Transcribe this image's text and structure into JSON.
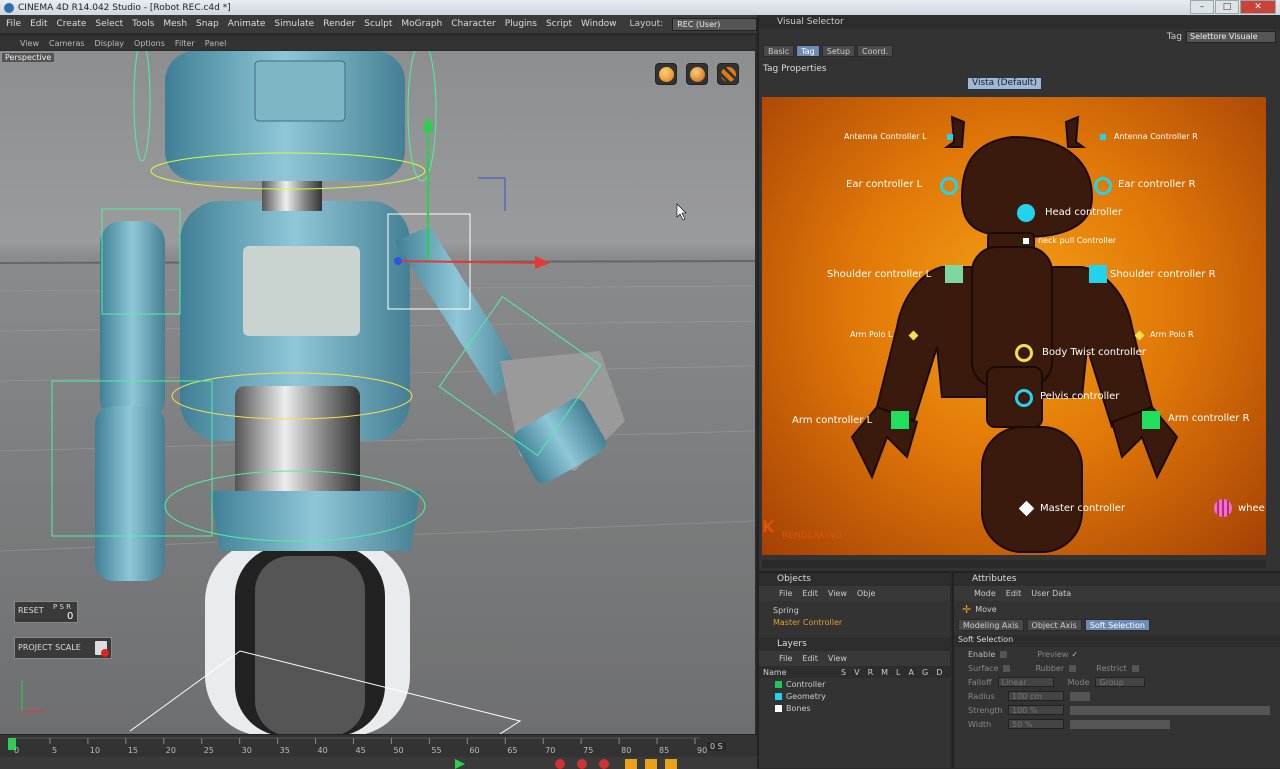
{
  "window": {
    "title": "CINEMA 4D R14.042 Studio - [Robot REC.c4d *]"
  },
  "menubar": {
    "items": [
      "File",
      "Edit",
      "Create",
      "Select",
      "Tools",
      "Mesh",
      "Snap",
      "Animate",
      "Simulate",
      "Render",
      "Sculpt",
      "MoGraph",
      "Character",
      "Plugins",
      "Script",
      "Window"
    ],
    "layout_label": "Layout:",
    "layout_value": "REC (User)"
  },
  "viewport": {
    "menu": [
      "View",
      "Cameras",
      "Display",
      "Options",
      "Filter",
      "Panel"
    ],
    "label": "Perspective",
    "reset_label": "RESET",
    "psr_label": "P S R",
    "psr_value": "0",
    "project_scale_label": "PROJECT SCALE"
  },
  "timeline": {
    "ticks": [
      "0",
      "5",
      "10",
      "15",
      "20",
      "25",
      "30",
      "35",
      "40",
      "45",
      "50",
      "55",
      "60",
      "65",
      "70",
      "75",
      "80",
      "85",
      "90"
    ],
    "end_value": "0 S"
  },
  "visual_selector": {
    "title": "Visual Selector",
    "tabs": [
      "Basic",
      "Tag",
      "Setup",
      "Coord."
    ],
    "active_tab": "Tag",
    "tag_label": "Tag",
    "tag_value": "Selettore Visuale",
    "tag_properties": "Tag Properties",
    "vista": "Vista (Default)",
    "brand": "RENDERKING",
    "controllers": {
      "antenna_l": "Antenna Controller  L",
      "antenna_r": "Antenna Controller  R",
      "ear_l": "Ear controller L",
      "ear_r": "Ear controller R",
      "head": "Head controller",
      "neck": "neck pull Controller",
      "shoulder_l": "Shoulder controller L",
      "shoulder_r": "Shoulder controller R",
      "armpolo_l": "Arm Polo L",
      "armpolo_r": "Arm Polo R",
      "body_twist": "Body Twist controller",
      "pelvis": "Pelvis controller",
      "arm_l": "Arm controller L",
      "arm_r": "Arm controller R",
      "master": "Master controller",
      "wheel": "whee"
    }
  },
  "objects_panel": {
    "title": "Objects",
    "menu": [
      "File",
      "Edit",
      "View",
      "Obje"
    ],
    "items": [
      "Spring",
      "Master Controller"
    ]
  },
  "layers_panel": {
    "title": "Layers",
    "menu": [
      "File",
      "Edit",
      "View"
    ],
    "columns": [
      "Name",
      "S",
      "V",
      "R",
      "M",
      "L",
      "A",
      "G",
      "D"
    ],
    "rows": [
      {
        "name": "Controller",
        "color": "#21c55d"
      },
      {
        "name": "Geometry",
        "color": "#22d3ee"
      },
      {
        "name": "Bones",
        "color": "#ffffff"
      }
    ]
  },
  "attributes_panel": {
    "title": "Attributes",
    "menu": [
      "Mode",
      "Edit",
      "User Data"
    ],
    "tool": "Move",
    "tabs": [
      "Modeling Axis",
      "Object Axis",
      "Soft Selection"
    ],
    "active_tab": "Soft Selection",
    "section": "Soft Selection",
    "fields": {
      "enable": "Enable",
      "preview": "Preview",
      "surface": "Surface",
      "rubber": "Rubber",
      "restrict": "Restrict",
      "falloff": "Falloff",
      "falloff_value": "Linear",
      "mode": "Mode",
      "mode_value": "Group",
      "radius": "Radius",
      "radius_value": "100 cm",
      "strength": "Strength",
      "strength_value": "100 %",
      "width": "Width",
      "width_value": "50 %"
    }
  }
}
